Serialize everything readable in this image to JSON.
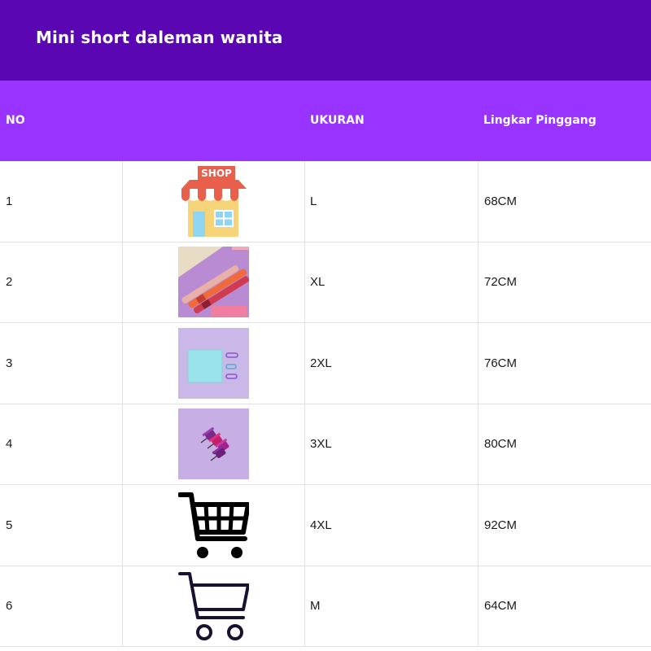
{
  "title": "Mini short daleman wanita",
  "table": {
    "headers": {
      "no": "NO",
      "image": "",
      "size": "UKURAN",
      "waist": "Lingkar Pinggang"
    },
    "rows": [
      {
        "no": "1",
        "image": "shop-icon",
        "size": "L",
        "waist": "68CM"
      },
      {
        "no": "2",
        "image": "pens-photo",
        "size": "XL",
        "waist": "72CM"
      },
      {
        "no": "3",
        "image": "sticky-note-photo",
        "size": "2XL",
        "waist": "76CM"
      },
      {
        "no": "4",
        "image": "push-pins-photo",
        "size": "3XL",
        "waist": "80CM"
      },
      {
        "no": "5",
        "image": "shopping-cart-icon",
        "size": "4XL",
        "waist": "92CM"
      },
      {
        "no": "6",
        "image": "shopping-cart-outline-icon",
        "size": "M",
        "waist": "64CM"
      }
    ]
  },
  "shop_sign": "SHOP",
  "colors": {
    "title_bar": "#5b06b3",
    "header_row": "#9933ff",
    "grid_line": "#e2e2e2"
  }
}
